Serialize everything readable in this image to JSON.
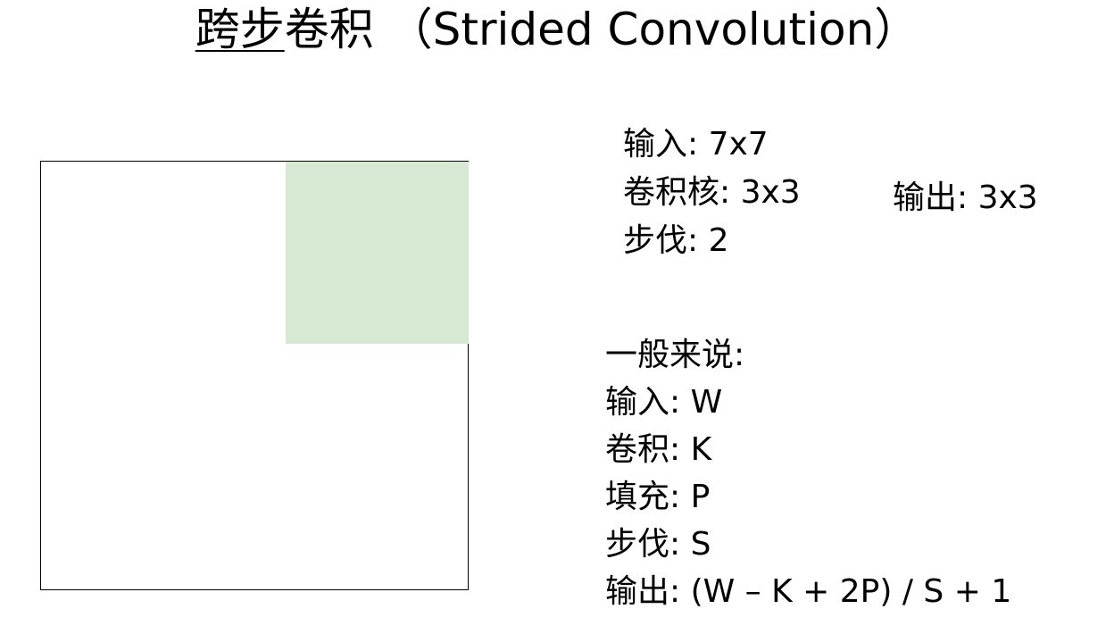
{
  "title": {
    "underlined": "跨步",
    "rest": "卷积 （Strided Convolution）"
  },
  "diagram": {
    "kernel_color": "#d8e9d3",
    "frame_color": "#000000"
  },
  "example": {
    "input": "输入: 7x7",
    "kernel": "卷积核: 3x3",
    "stride": "步伐: 2",
    "output": "输出: 3x3"
  },
  "general": {
    "heading": "一般来说:",
    "input": "输入: W",
    "kernel": "卷积: K",
    "padding": "填充: P",
    "stride": "步伐: S",
    "output": "输出: (W – K + 2P) / S + 1"
  }
}
